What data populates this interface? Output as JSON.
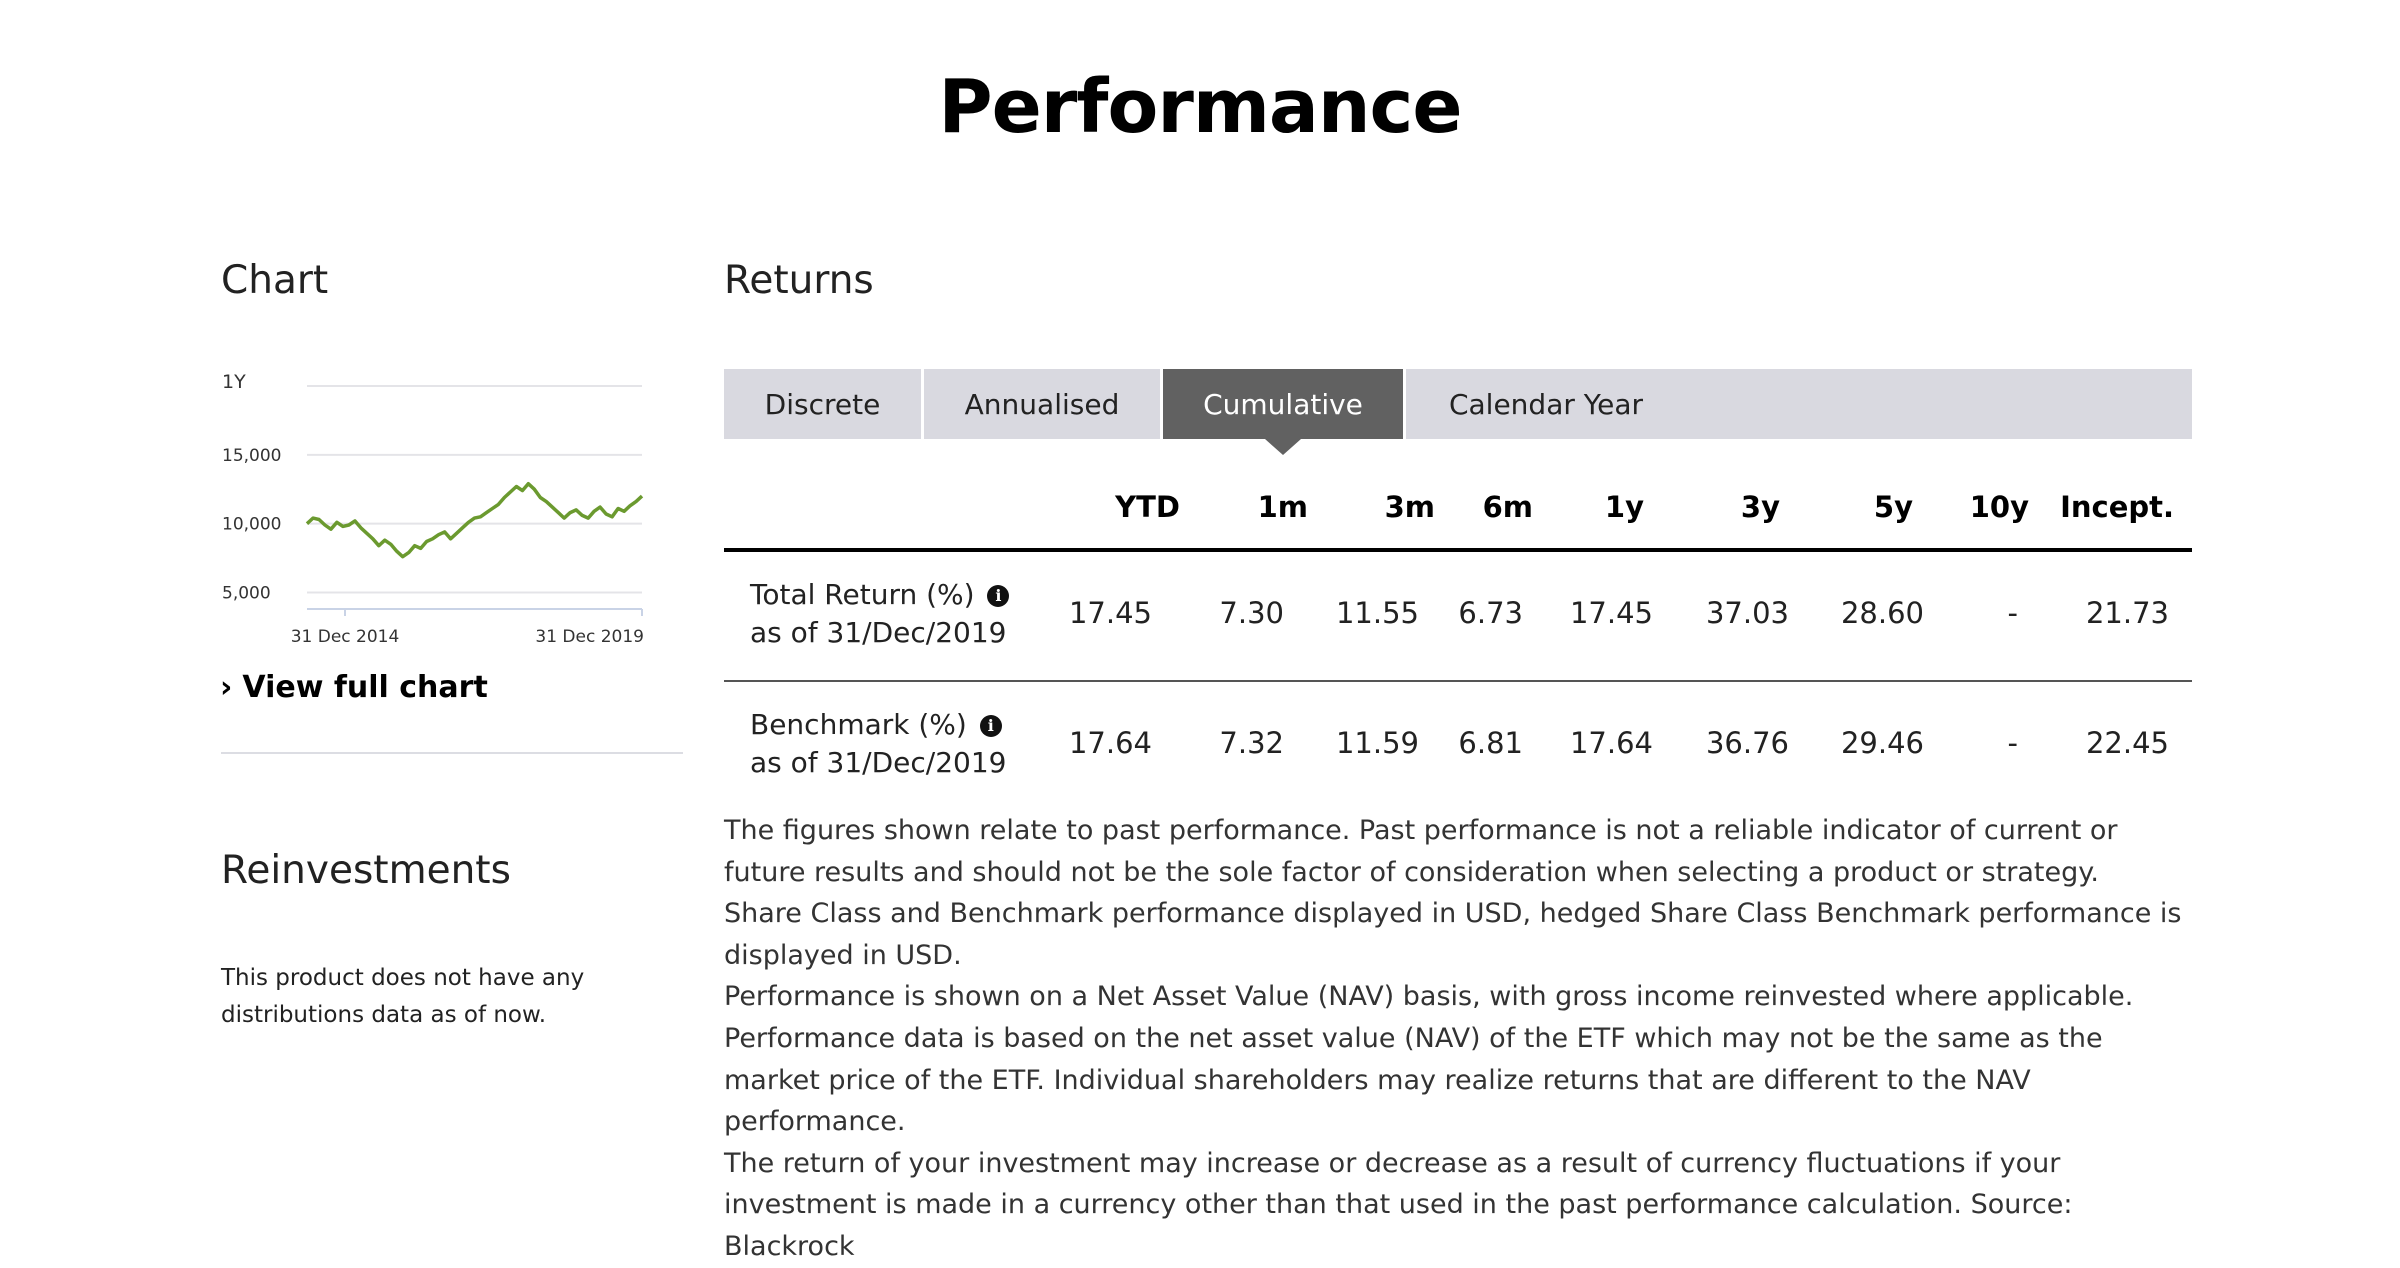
{
  "page": {
    "title": "Performance"
  },
  "chart_section": {
    "title": "Chart",
    "period_label": "1Y",
    "view_full_chart": "View full chart",
    "line_color": "#6b9a2f"
  },
  "chart_data": {
    "type": "line",
    "y_ticks": [
      "15,000",
      "10,000",
      "5,000"
    ],
    "y_tick_values": [
      15000,
      10000,
      5000
    ],
    "x_ticks": [
      "31 Dec 2014",
      "31 Dec 2019"
    ],
    "ylim": [
      5000,
      20000
    ],
    "grid": true,
    "series": [
      {
        "values": [
          10000,
          10400,
          10300,
          9900,
          9600,
          10100,
          9800,
          9900,
          10200,
          9700,
          9300,
          8900,
          8400,
          8800,
          8500,
          8000,
          7600,
          7900,
          8400,
          8200,
          8700,
          8900,
          9200,
          9400,
          8900,
          9300,
          9700,
          10100,
          10400,
          10500,
          10800,
          11100,
          11400,
          11900,
          12300,
          12700,
          12400,
          12900,
          12500,
          11900,
          11600,
          11200,
          10800,
          10400,
          10800,
          11000,
          10600,
          10400,
          10900,
          11200,
          10700,
          10500,
          11100,
          10900,
          11300,
          11600,
          12000
        ]
      }
    ]
  },
  "returns": {
    "title": "Returns",
    "tabs": [
      {
        "label": "Discrete",
        "active": false
      },
      {
        "label": "Annualised",
        "active": false
      },
      {
        "label": "Cumulative",
        "active": true
      },
      {
        "label": "Calendar Year",
        "active": false
      }
    ],
    "columns": [
      "YTD",
      "1m",
      "3m",
      "6m",
      "1y",
      "3y",
      "5y",
      "10y",
      "Incept."
    ],
    "rows": [
      {
        "label": "Total Return (%)",
        "as_of": "as of 31/Dec/2019",
        "values": [
          "17.45",
          "7.30",
          "11.55",
          "6.73",
          "17.45",
          "37.03",
          "28.60",
          "-",
          "21.73"
        ]
      },
      {
        "label": "Benchmark (%)",
        "as_of": "as of 31/Dec/2019",
        "values": [
          "17.64",
          "7.32",
          "11.59",
          "6.81",
          "17.64",
          "36.76",
          "29.46",
          "-",
          "22.45"
        ]
      }
    ],
    "info_icon": "info-icon",
    "disclaimer": [
      "The figures shown relate to past performance. Past performance is not a reliable indicator of current or future results and should not be the sole factor of consideration when selecting a product or strategy.",
      "Share Class and Benchmark performance displayed in USD, hedged Share Class Benchmark performance is displayed in USD.",
      "Performance is shown on a Net Asset Value (NAV) basis, with gross income reinvested where applicable.",
      "Performance data is based on the net asset value (NAV) of the ETF which may not be the same as the market price of the ETF. Individual shareholders may realize returns that are different to the NAV performance.",
      "The return of your investment may increase or decrease as a result of currency fluctuations if your investment is made in a currency other than that used in the past performance calculation. Source: Blackrock"
    ]
  },
  "reinvestments": {
    "title": "Reinvestments",
    "text": "This product does not have any distributions data as of now."
  }
}
